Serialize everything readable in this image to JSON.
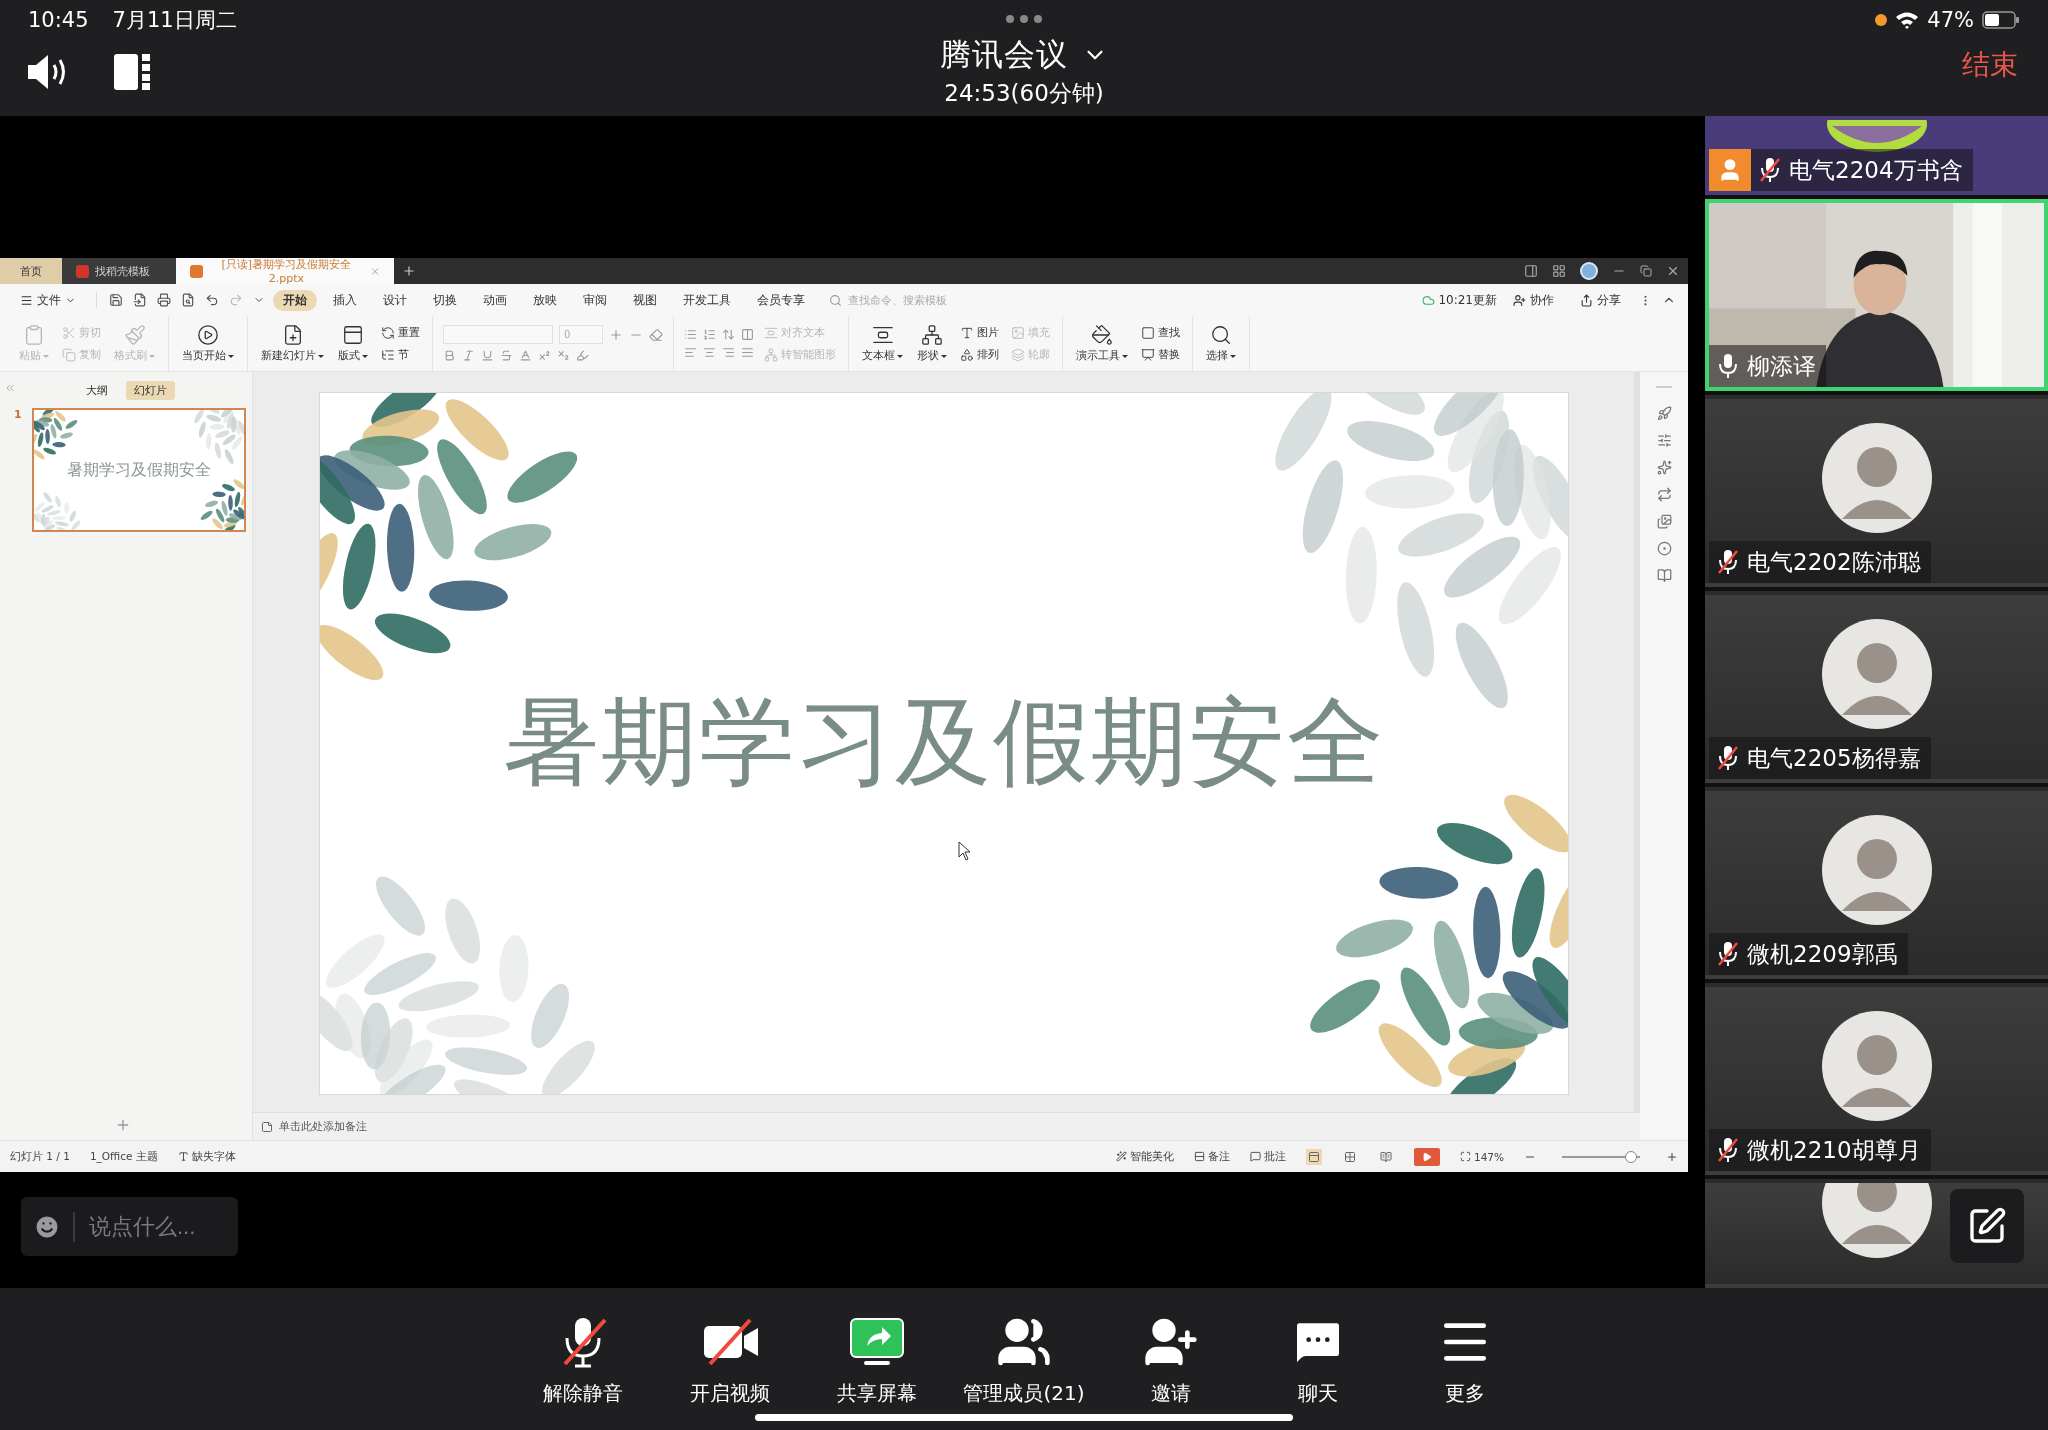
{
  "device_status": {
    "time": "10:45",
    "date": "7月11日周二",
    "battery": "47%"
  },
  "meeting": {
    "title": "腾讯会议",
    "duration": "24:53(60分钟)",
    "end_button": "结束"
  },
  "wps": {
    "tabs": [
      {
        "label": "首页",
        "kind": "home",
        "selected": false
      },
      {
        "label": "找稻壳模板",
        "kind": "template",
        "selected": false
      },
      {
        "label": "[只读]暑期学习及假期安全2.pptx",
        "kind": "document",
        "selected": true
      }
    ],
    "file_menu": "文件",
    "menu_tabs": [
      {
        "label": "开始",
        "selected": true
      },
      {
        "label": "插入",
        "selected": false
      },
      {
        "label": "设计",
        "selected": false
      },
      {
        "label": "切换",
        "selected": false
      },
      {
        "label": "动画",
        "selected": false
      },
      {
        "label": "放映",
        "selected": false
      },
      {
        "label": "审阅",
        "selected": false
      },
      {
        "label": "视图",
        "selected": false
      },
      {
        "label": "开发工具",
        "selected": false
      },
      {
        "label": "会员专享",
        "selected": false
      }
    ],
    "search_placeholder": "查找命令、搜索模板",
    "cloud_status": "10:21更新",
    "collaborate": "协作",
    "share": "分享",
    "ribbon": [
      {
        "kind": "tools",
        "items": [
          {
            "label": "粘贴",
            "kind": "large",
            "disabled": true
          },
          {
            "label": "剪切",
            "kind": "small",
            "disabled": true
          },
          {
            "label": "复制",
            "kind": "small",
            "disabled": true
          },
          {
            "label": "格式刷",
            "kind": "large",
            "disabled": true
          }
        ]
      },
      {
        "kind": "tools",
        "items": [
          {
            "label": "当页开始",
            "kind": "large",
            "disabled": false
          }
        ]
      },
      {
        "kind": "tools",
        "items": [
          {
            "label": "新建幻灯片",
            "kind": "large",
            "disabled": false
          },
          {
            "label": "版式",
            "kind": "large",
            "disabled": false
          },
          {
            "label": "重置",
            "kind": "small",
            "disabled": false
          },
          {
            "label": "节",
            "kind": "small",
            "disabled": false
          }
        ]
      },
      {
        "kind": "font",
        "font_size": "0"
      },
      {
        "kind": "paragraph",
        "items": [
          {
            "label": "对齐文本",
            "kind": "small",
            "disabled": true
          },
          {
            "label": "转智能图形",
            "kind": "small",
            "disabled": true
          }
        ]
      },
      {
        "kind": "tools",
        "items": [
          {
            "label": "文本框",
            "kind": "large",
            "disabled": false
          },
          {
            "label": "形状",
            "kind": "large",
            "disabled": false
          },
          {
            "label": "图片",
            "kind": "small",
            "disabled": false
          },
          {
            "label": "排列",
            "kind": "small",
            "disabled": false
          },
          {
            "label": "填充",
            "kind": "small",
            "disabled": true
          },
          {
            "label": "轮廓",
            "kind": "small",
            "disabled": true
          }
        ]
      },
      {
        "kind": "tools",
        "items": [
          {
            "label": "演示工具",
            "kind": "large",
            "disabled": false
          },
          {
            "label": "查找",
            "kind": "small",
            "disabled": false
          },
          {
            "label": "替换",
            "kind": "small",
            "disabled": false
          }
        ]
      },
      {
        "kind": "tools",
        "items": [
          {
            "label": "选择",
            "kind": "large",
            "disabled": false
          }
        ]
      }
    ],
    "panel_tabs": [
      {
        "label": "大纲",
        "selected": false
      },
      {
        "label": "幻灯片",
        "selected": true
      }
    ],
    "slides": [
      {
        "number": "1",
        "title": "暑期学习及假期安全",
        "selected": true
      }
    ],
    "slide": {
      "title": "暑期学习及假期安全"
    },
    "notes_placeholder": "单击此处添加备注",
    "status_bar": {
      "slide_count": "幻灯片 1 / 1",
      "theme": "1_Office 主题",
      "missing_fonts": "缺失字体",
      "beautify": "智能美化",
      "notes": "备注",
      "comments": "批注",
      "zoom": "147%",
      "level": 0.88
    }
  },
  "chat_placeholder": "说点什么...",
  "participants": [
    {
      "name": "电气2204万书含",
      "kind": "cartoon",
      "muted": true,
      "host": true,
      "speaking": false
    },
    {
      "name": "柳添译",
      "kind": "video",
      "muted": false,
      "host": false,
      "speaking": true
    },
    {
      "name": "电气2202陈沛聪",
      "kind": "avatar",
      "muted": true,
      "host": false,
      "speaking": false
    },
    {
      "name": "电气2205杨得嘉",
      "kind": "avatar",
      "muted": true,
      "host": false,
      "speaking": false
    },
    {
      "name": "微机2209郭禹",
      "kind": "avatar",
      "muted": true,
      "host": false,
      "speaking": false
    },
    {
      "name": "微机2210胡尊月",
      "kind": "avatar",
      "muted": true,
      "host": false,
      "speaking": false
    },
    {
      "kind": "avatar",
      "speaking": false
    }
  ],
  "toolbar": [
    {
      "label": "解除静音",
      "kind": "mic",
      "off": true
    },
    {
      "label": "开启视频",
      "kind": "video",
      "off": true
    },
    {
      "label": "共享屏幕",
      "kind": "share"
    },
    {
      "label": "管理成员(21)",
      "kind": "members"
    },
    {
      "label": "邀请",
      "kind": "invite"
    },
    {
      "label": "聊天",
      "kind": "chat"
    },
    {
      "label": "更多",
      "kind": "more"
    }
  ]
}
